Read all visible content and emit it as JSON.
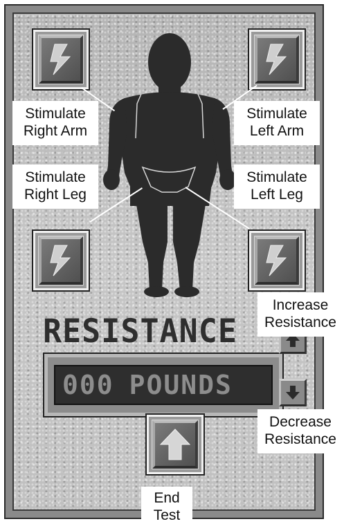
{
  "controls": {
    "stim_right_arm": {
      "line1": "Stimulate",
      "line2": "Right Arm",
      "icon": "lightning-bolt-icon"
    },
    "stim_left_arm": {
      "line1": "Stimulate",
      "line2": "Left Arm",
      "icon": "lightning-bolt-icon"
    },
    "stim_right_leg": {
      "line1": "Stimulate",
      "line2": "Right Leg",
      "icon": "lightning-bolt-icon"
    },
    "stim_left_leg": {
      "line1": "Stimulate",
      "line2": "Left Leg",
      "icon": "lightning-bolt-icon"
    }
  },
  "resistance": {
    "title": "RESISTANCE",
    "value": "000",
    "unit": "POUNDS",
    "increase": {
      "line1": "Increase",
      "line2": "Resistance",
      "icon": "arrow-up-icon"
    },
    "decrease": {
      "line1": "Decrease",
      "line2": "Resistance",
      "icon": "arrow-down-icon"
    }
  },
  "end_test": {
    "line1": "End",
    "line2": "Test",
    "icon": "arrow-up-icon"
  },
  "colors": {
    "panel": "#b9b9b9",
    "silhouette": "#2b2b2b",
    "button_face": "#6a6a6a",
    "label_bg": "#ffffff"
  }
}
